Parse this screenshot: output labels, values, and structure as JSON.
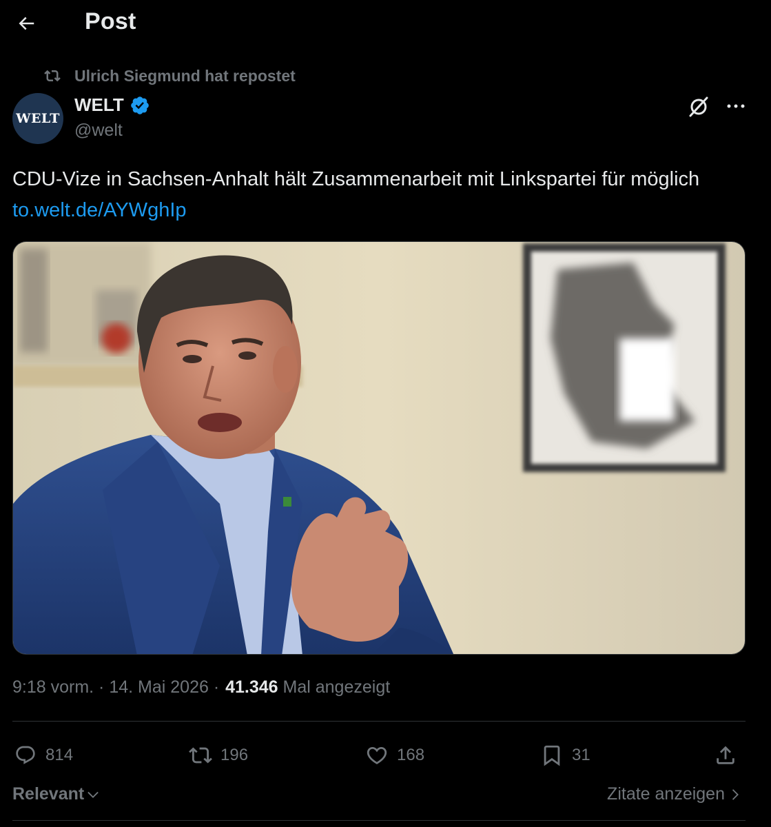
{
  "header": {
    "title": "Post"
  },
  "repost": {
    "text": "Ulrich Siegmund hat repostet"
  },
  "author": {
    "avatar_text": "WELT",
    "name": "WELT",
    "handle": "@welt",
    "avatar_color": "#1f3551",
    "verified_color": "#1d9bf0"
  },
  "post": {
    "text": "CDU-Vize in Sachsen-Anhalt hält Zusammenarbeit mit Linkspartei für möglich",
    "link": "to.welt.de/AYWghIp"
  },
  "meta": {
    "time": "9:18 vorm.",
    "date": "14. Mai 2026",
    "views": "41.346",
    "views_label": "Mal angezeigt"
  },
  "actions": {
    "replies": "814",
    "reposts": "196",
    "likes": "168",
    "bookmarks": "31"
  },
  "footer": {
    "sort_label": "Relevant",
    "quotes_label": "Zitate anzeigen"
  },
  "colors": {
    "background": "#000000",
    "text": "#e7e9ea",
    "muted": "#71767b",
    "link": "#1d9bf0",
    "divider": "#2f3336"
  },
  "icons": [
    "back-arrow-icon",
    "repost-icon",
    "verified-badge-icon",
    "grok-icon",
    "more-icon",
    "reply-icon",
    "like-icon",
    "bookmark-icon",
    "share-icon",
    "chevron-down-icon",
    "chevron-right-icon"
  ]
}
